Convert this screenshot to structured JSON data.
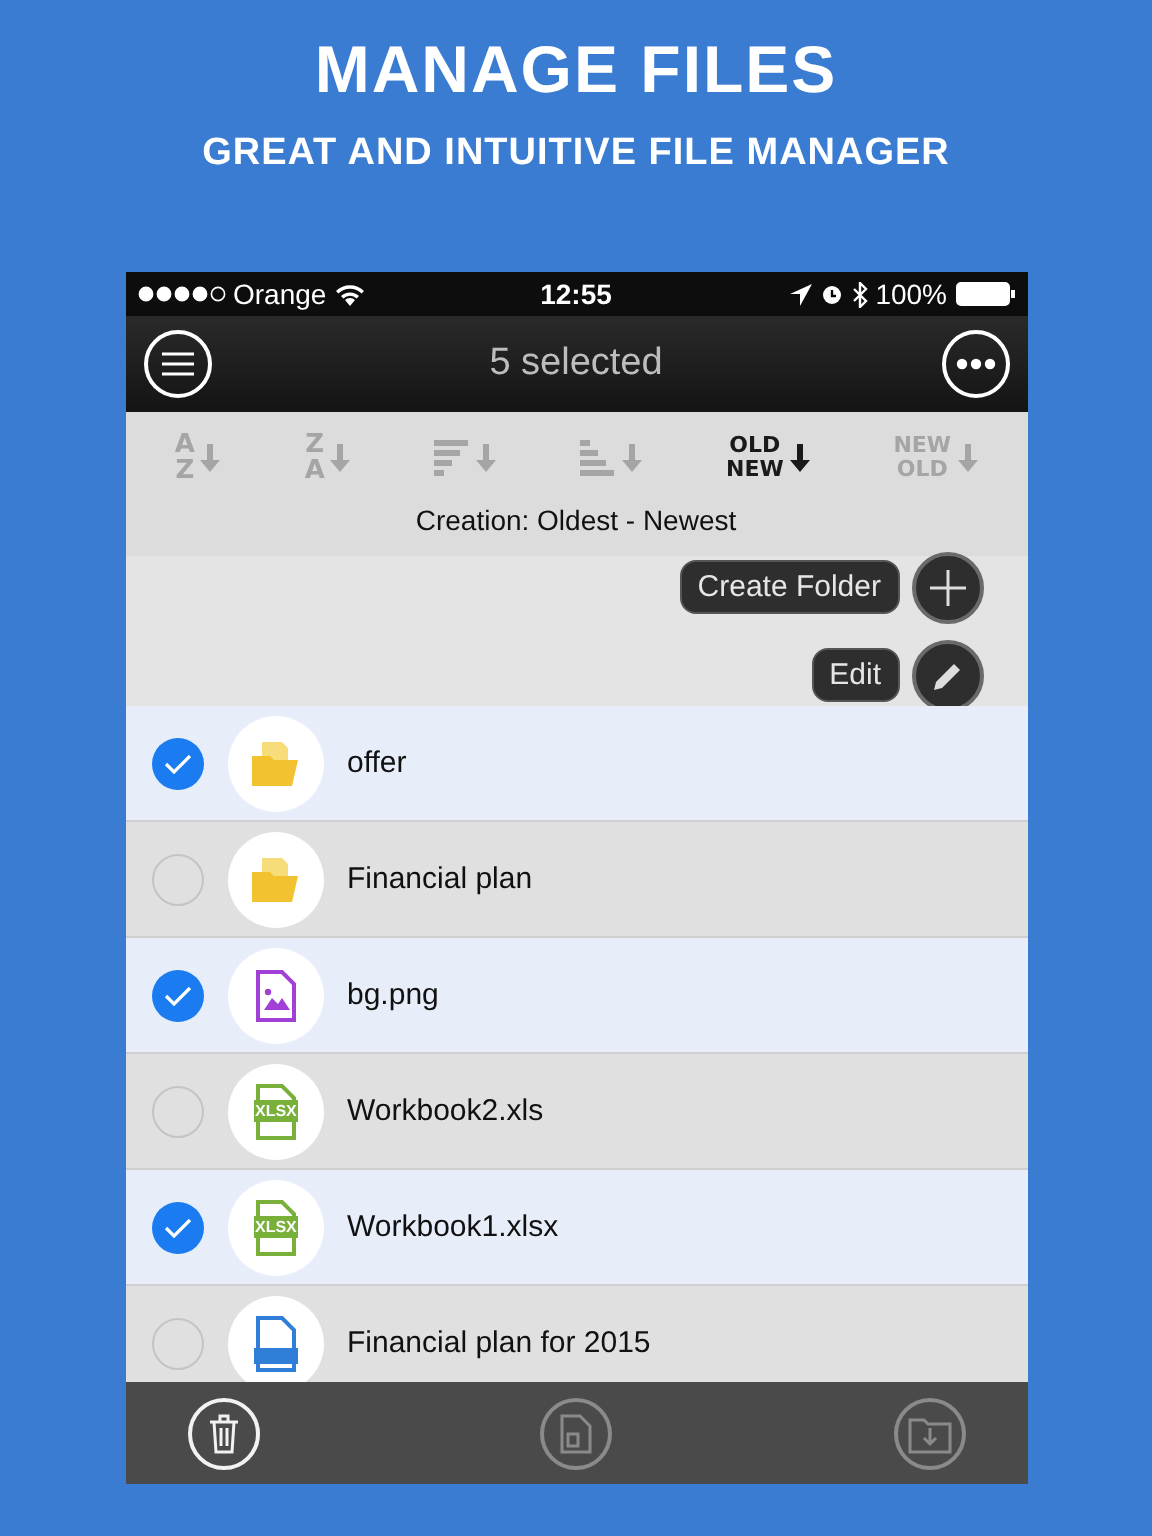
{
  "headline": "MANAGE FILES",
  "subheadline": "GREAT AND INTUITIVE FILE MANAGER",
  "status_bar": {
    "carrier": "Orange",
    "time": "12:55",
    "battery": "100%"
  },
  "nav": {
    "title": "5 selected"
  },
  "sort_options": [
    {
      "kind": "letters",
      "top": "A",
      "bottom": "Z",
      "selected": false
    },
    {
      "kind": "letters",
      "top": "Z",
      "bottom": "A",
      "selected": false
    },
    {
      "kind": "bars_desc",
      "selected": false
    },
    {
      "kind": "bars_asc",
      "selected": false
    },
    {
      "kind": "letters",
      "top": "OLD",
      "bottom": "NEW",
      "selected": true
    },
    {
      "kind": "letters",
      "top": "NEW",
      "bottom": "OLD",
      "selected": false
    }
  ],
  "sort_label": "Creation: Oldest - Newest",
  "actions": [
    {
      "kind": "add",
      "label": "Create Folder"
    },
    {
      "kind": "edit",
      "label": "Edit"
    }
  ],
  "files": [
    {
      "name": "offer",
      "kind": "folder",
      "selected": true
    },
    {
      "name": "Financial plan",
      "kind": "folder",
      "selected": false
    },
    {
      "name": "bg.png",
      "kind": "image",
      "selected": true
    },
    {
      "name": "Workbook2.xls",
      "kind": "sheet",
      "badge": "XLSX",
      "selected": false
    },
    {
      "name": "Workbook1.xlsx",
      "kind": "sheet",
      "badge": "XLSX",
      "selected": true
    },
    {
      "name": "Financial plan for 2015",
      "kind": "doc",
      "selected": false
    }
  ],
  "toolbar": [
    {
      "kind": "trash",
      "active": true
    },
    {
      "kind": "zip",
      "active": false
    },
    {
      "kind": "move",
      "active": false
    }
  ]
}
